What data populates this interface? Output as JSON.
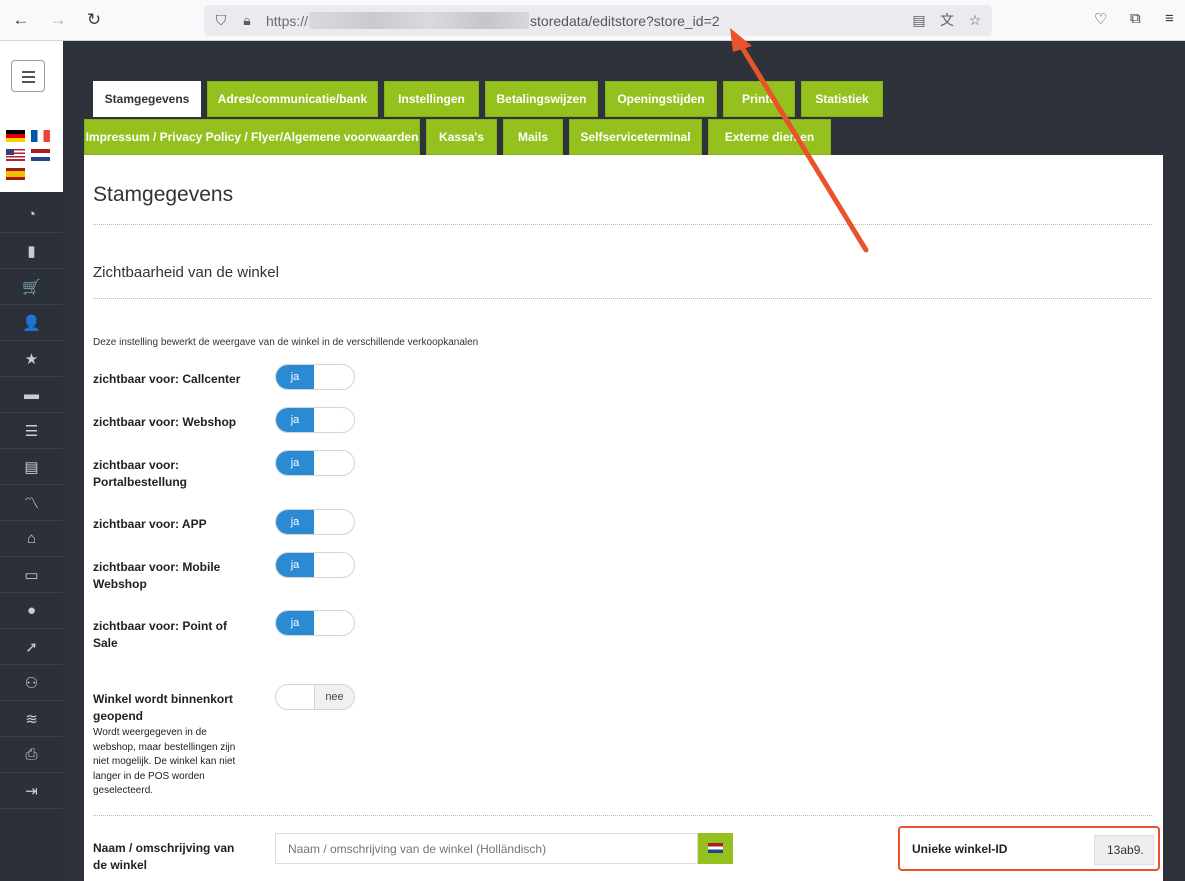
{
  "browser": {
    "url_prefix": "https://",
    "url_suffix": "storedata/editstore?store_id=2",
    "icons": [
      "back-arrow-icon",
      "forward-arrow-icon",
      "reload-icon",
      "shield-icon",
      "lock-icon",
      "reader-view-icon",
      "translate-icon",
      "star-icon",
      "pocket-icon",
      "extensions-icon",
      "menu-icon"
    ]
  },
  "sidebar": {
    "menu_icon": "hamburger-icon",
    "flags": [
      "de",
      "fr",
      "us",
      "nl",
      "es"
    ],
    "items": [
      {
        "icon": "dashboard-icon",
        "glyph": "◔"
      },
      {
        "icon": "bar-chart-icon",
        "glyph": "▮"
      },
      {
        "icon": "cart-icon",
        "glyph": "🛒"
      },
      {
        "icon": "user-plus-icon",
        "glyph": "👤"
      },
      {
        "icon": "star-icon",
        "glyph": "★"
      },
      {
        "icon": "archive-icon",
        "glyph": "▬"
      },
      {
        "icon": "list-icon",
        "glyph": "☰"
      },
      {
        "icon": "book-icon",
        "glyph": "▤"
      },
      {
        "icon": "trend-icon",
        "glyph": "〽"
      },
      {
        "icon": "home-icon",
        "glyph": "⌂"
      },
      {
        "icon": "monitor-icon",
        "glyph": "▭"
      },
      {
        "icon": "user-icon",
        "glyph": "●"
      },
      {
        "icon": "rocket-icon",
        "glyph": "➚"
      },
      {
        "icon": "users-icon",
        "glyph": "⚇"
      },
      {
        "icon": "database-icon",
        "glyph": "≋"
      },
      {
        "icon": "print-icon",
        "glyph": "⎙"
      },
      {
        "icon": "logout-icon",
        "glyph": "⇥"
      }
    ]
  },
  "tabs_row1": [
    "Stamgegevens",
    "Adres/communicatie/bank",
    "Instellingen",
    "Betalingswijzen",
    "Openingstijden",
    "Printe",
    "Statistiek"
  ],
  "tabs_row2": [
    "Impressum / Privacy Policy / Flyer/Algemene voorwaarden",
    "Kassa's",
    "Mails",
    "Selfserviceterminal",
    "Externe dien en"
  ],
  "page": {
    "title": "Stamgegevens",
    "section_title": "Zichtbaarheid van de winkel",
    "description": "Deze instelling bewerkt de weergave van de winkel in de verschillende verkoopkanalen",
    "settings": [
      {
        "label": "zichtbaar voor: Callcenter",
        "state": "ja"
      },
      {
        "label": "zichtbaar voor: Webshop",
        "state": "ja"
      },
      {
        "label": "zichtbaar voor: Portalbestellung",
        "state": "ja"
      },
      {
        "label": "zichtbaar voor: APP",
        "state": "ja"
      },
      {
        "label": "zichtbaar voor: Mobile Webshop",
        "state": "ja"
      },
      {
        "label": "zichtbaar voor: Point of Sale",
        "state": "ja"
      }
    ],
    "opening_soon": {
      "label": "Winkel wordt binnenkort geopend",
      "note": "Wordt weergegeven in de webshop, maar bestellingen zijn niet mogelijk. De winkel kan niet langer in de POS worden geselecteerd.",
      "state": "nee"
    },
    "name_field": {
      "label": "Naam / omschrijving van de winkel",
      "placeholder": "Naam / omschrijving van de winkel (Holländisch)",
      "lang_flag": "nl"
    },
    "unique_id": {
      "label": "Unieke winkel-ID",
      "value": "13ab9."
    }
  },
  "colors": {
    "tab_green": "#95c11f",
    "toggle_blue": "#2a8bd3",
    "annotation_red": "#e8532c",
    "sidebar_dark": "#2c3139"
  }
}
